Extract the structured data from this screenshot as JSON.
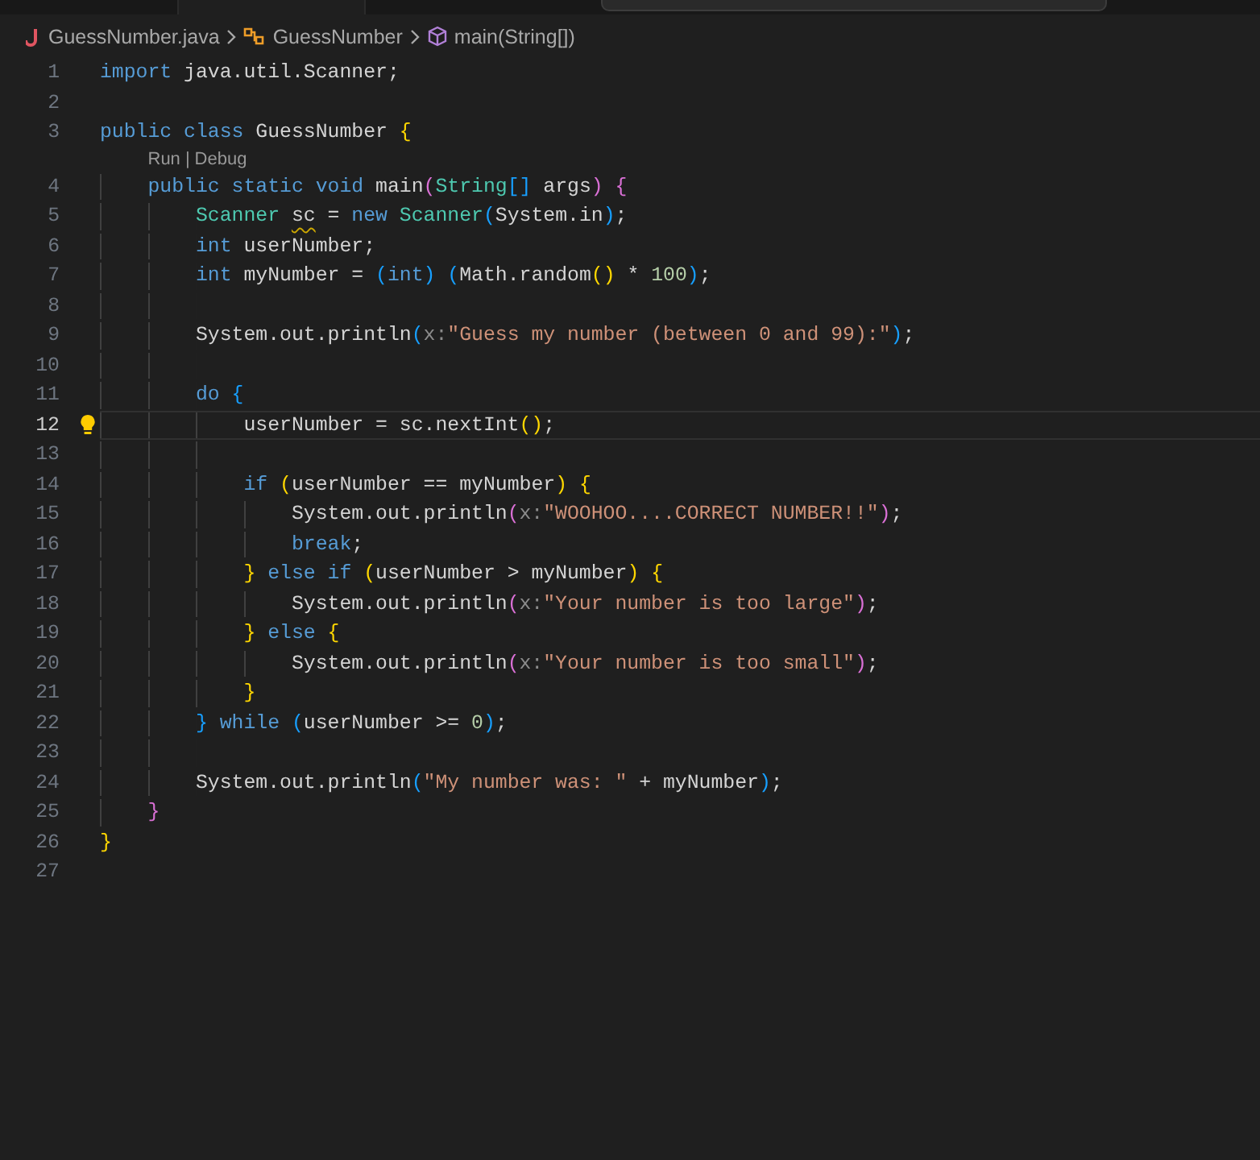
{
  "breadcrumb": [
    {
      "kind": "file",
      "label": "GuessNumber.java"
    },
    {
      "kind": "class",
      "label": "GuessNumber"
    },
    {
      "kind": "method",
      "label": "main(String[])"
    }
  ],
  "lines": [
    {
      "number": "1",
      "active": false,
      "tokens": [
        {
          "text": "import",
          "kind": "keyword"
        },
        {
          "text": " java.util.Scanner;",
          "kind": "plain"
        }
      ]
    },
    {
      "number": "2",
      "active": false
    },
    {
      "number": "3",
      "active": false,
      "tokens": [
        {
          "text": "public class ",
          "kind": "keyword"
        },
        {
          "text": "GuessNumber ",
          "kind": "plain"
        },
        {
          "text": "{",
          "kind": "bracket1"
        }
      ]
    },
    {
      "number": "4",
      "active": false,
      "codelens": {
        "items": [
          "Run",
          "Debug"
        ],
        "separator": "|"
      },
      "tokens": [
        {
          "text": "    public static void ",
          "kind": "keyword"
        },
        {
          "text": "main",
          "kind": "plain"
        },
        {
          "text": "(",
          "kind": "bracket2"
        },
        {
          "text": "String",
          "kind": "type"
        },
        {
          "text": "[]",
          "kind": "bracket3"
        },
        {
          "text": " args",
          "kind": "plain"
        },
        {
          "text": ") ",
          "kind": "bracket2"
        },
        {
          "text": "{",
          "kind": "bracket2"
        }
      ]
    },
    {
      "number": "5",
      "active": false,
      "tokens": [
        {
          "text": "        Scanner ",
          "kind": "type"
        },
        {
          "text": "sc",
          "kind": "plain",
          "squiggle": true
        },
        {
          "text": " = ",
          "kind": "plain"
        },
        {
          "text": "new ",
          "kind": "keyword"
        },
        {
          "text": "Scanner",
          "kind": "type"
        },
        {
          "text": "(",
          "kind": "bracket3"
        },
        {
          "text": "System.in",
          "kind": "plain"
        },
        {
          "text": ")",
          "kind": "bracket3"
        },
        {
          "text": ";",
          "kind": "plain"
        }
      ]
    },
    {
      "number": "6",
      "active": false,
      "tokens": [
        {
          "text": "        int ",
          "kind": "keyword"
        },
        {
          "text": "userNumber;",
          "kind": "plain"
        }
      ]
    },
    {
      "number": "7",
      "active": false,
      "tokens": [
        {
          "text": "        int ",
          "kind": "keyword"
        },
        {
          "text": "myNumber = ",
          "kind": "plain"
        },
        {
          "text": "(",
          "kind": "bracket3"
        },
        {
          "text": "int",
          "kind": "keyword"
        },
        {
          "text": ") ",
          "kind": "bracket3"
        },
        {
          "text": "(",
          "kind": "bracket3"
        },
        {
          "text": "Math.random",
          "kind": "plain"
        },
        {
          "text": "()",
          "kind": "bracket1"
        },
        {
          "text": " * ",
          "kind": "plain"
        },
        {
          "text": "100",
          "kind": "number"
        },
        {
          "text": ")",
          "kind": "bracket3"
        },
        {
          "text": ";",
          "kind": "plain"
        }
      ]
    },
    {
      "number": "8",
      "active": false
    },
    {
      "number": "9",
      "active": false,
      "tokens": [
        {
          "text": "        System.out.println",
          "kind": "plain"
        },
        {
          "text": "(",
          "kind": "bracket3"
        },
        {
          "text": "x:",
          "kind": "hint"
        },
        {
          "text": "\"Guess my number (between 0 and 99):\"",
          "kind": "string"
        },
        {
          "text": ")",
          "kind": "bracket3"
        },
        {
          "text": ";",
          "kind": "plain"
        }
      ]
    },
    {
      "number": "10",
      "active": false
    },
    {
      "number": "11",
      "active": false,
      "tokens": [
        {
          "text": "        do ",
          "kind": "keyword"
        },
        {
          "text": "{",
          "kind": "bracket3"
        }
      ]
    },
    {
      "number": "12",
      "active": true,
      "tokens": [
        {
          "text": "            userNumber = sc.nextInt",
          "kind": "plain"
        },
        {
          "text": "()",
          "kind": "bracket1"
        },
        {
          "text": ";",
          "kind": "plain"
        }
      ]
    },
    {
      "number": "13",
      "active": false
    },
    {
      "number": "14",
      "active": false,
      "tokens": [
        {
          "text": "            if ",
          "kind": "keyword"
        },
        {
          "text": "(",
          "kind": "bracket1"
        },
        {
          "text": "userNumber == myNumber",
          "kind": "plain"
        },
        {
          "text": ") ",
          "kind": "bracket1"
        },
        {
          "text": "{",
          "kind": "bracket1"
        }
      ]
    },
    {
      "number": "15",
      "active": false,
      "tokens": [
        {
          "text": "                System.out.println",
          "kind": "plain"
        },
        {
          "text": "(",
          "kind": "bracket2"
        },
        {
          "text": "x:",
          "kind": "hint"
        },
        {
          "text": "\"WOOHOO....CORRECT NUMBER!!\"",
          "kind": "string"
        },
        {
          "text": ")",
          "kind": "bracket2"
        },
        {
          "text": ";",
          "kind": "plain"
        }
      ]
    },
    {
      "number": "16",
      "active": false,
      "tokens": [
        {
          "text": "                break",
          "kind": "keyword"
        },
        {
          "text": ";",
          "kind": "plain"
        }
      ]
    },
    {
      "number": "17",
      "active": false,
      "tokens": [
        {
          "text": "            }",
          "kind": "bracket1"
        },
        {
          "text": " else if ",
          "kind": "keyword"
        },
        {
          "text": "(",
          "kind": "bracket1"
        },
        {
          "text": "userNumber > myNumber",
          "kind": "plain"
        },
        {
          "text": ") ",
          "kind": "bracket1"
        },
        {
          "text": "{",
          "kind": "bracket1"
        }
      ]
    },
    {
      "number": "18",
      "active": false,
      "tokens": [
        {
          "text": "                System.out.println",
          "kind": "plain"
        },
        {
          "text": "(",
          "kind": "bracket2"
        },
        {
          "text": "x:",
          "kind": "hint"
        },
        {
          "text": "\"Your number is too large\"",
          "kind": "string"
        },
        {
          "text": ")",
          "kind": "bracket2"
        },
        {
          "text": ";",
          "kind": "plain"
        }
      ]
    },
    {
      "number": "19",
      "active": false,
      "tokens": [
        {
          "text": "            }",
          "kind": "bracket1"
        },
        {
          "text": " else ",
          "kind": "keyword"
        },
        {
          "text": "{",
          "kind": "bracket1"
        }
      ]
    },
    {
      "number": "20",
      "active": false,
      "tokens": [
        {
          "text": "                System.out.println",
          "kind": "plain"
        },
        {
          "text": "(",
          "kind": "bracket2"
        },
        {
          "text": "x:",
          "kind": "hint"
        },
        {
          "text": "\"Your number is too small\"",
          "kind": "string"
        },
        {
          "text": ")",
          "kind": "bracket2"
        },
        {
          "text": ";",
          "kind": "plain"
        }
      ]
    },
    {
      "number": "21",
      "active": false,
      "tokens": [
        {
          "text": "            }",
          "kind": "bracket1"
        }
      ]
    },
    {
      "number": "22",
      "active": false,
      "tokens": [
        {
          "text": "        }",
          "kind": "bracket3"
        },
        {
          "text": " while ",
          "kind": "keyword"
        },
        {
          "text": "(",
          "kind": "bracket3"
        },
        {
          "text": "userNumber >= ",
          "kind": "plain"
        },
        {
          "text": "0",
          "kind": "number"
        },
        {
          "text": ")",
          "kind": "bracket3"
        },
        {
          "text": ";",
          "kind": "plain"
        }
      ]
    },
    {
      "number": "23",
      "active": false
    },
    {
      "number": "24",
      "active": false,
      "tokens": [
        {
          "text": "        System.out.println",
          "kind": "plain"
        },
        {
          "text": "(",
          "kind": "bracket3"
        },
        {
          "text": "\"My number was: \"",
          "kind": "string"
        },
        {
          "text": " + myNumber",
          "kind": "plain"
        },
        {
          "text": ")",
          "kind": "bracket3"
        },
        {
          "text": ";",
          "kind": "plain"
        }
      ]
    },
    {
      "number": "25",
      "active": false,
      "tokens": [
        {
          "text": "    }",
          "kind": "bracket2"
        }
      ]
    },
    {
      "number": "26",
      "active": false,
      "tokens": [
        {
          "text": "}",
          "kind": "bracket1"
        }
      ]
    },
    {
      "number": "27",
      "active": false
    }
  ]
}
